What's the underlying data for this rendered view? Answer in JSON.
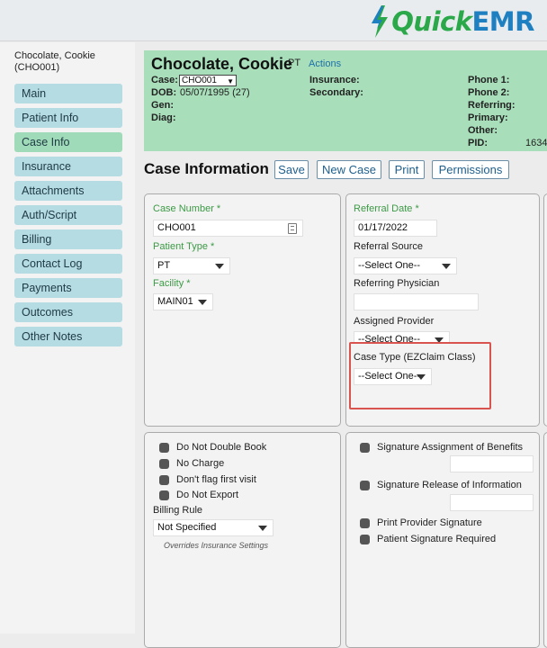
{
  "app": {
    "logo_quick": "Quick",
    "logo_emr": "EMR"
  },
  "patient": {
    "name_line1": "Chocolate, Cookie",
    "name_line2": "(CHO001)"
  },
  "sidebar": {
    "items": [
      {
        "label": "Main",
        "active": false
      },
      {
        "label": "Patient Info",
        "active": false
      },
      {
        "label": "Case Info",
        "active": true
      },
      {
        "label": "Insurance",
        "active": false
      },
      {
        "label": "Attachments",
        "active": false
      },
      {
        "label": "Auth/Script",
        "active": false
      },
      {
        "label": "Billing",
        "active": false
      },
      {
        "label": "Contact Log",
        "active": false
      },
      {
        "label": "Payments",
        "active": false
      },
      {
        "label": "Outcomes",
        "active": false
      },
      {
        "label": "Other Notes",
        "active": false
      }
    ]
  },
  "banner": {
    "name": "Chocolate, Cookie",
    "patient_type": "PT",
    "actions_label": "Actions",
    "case_label": "Case:",
    "case_value": "CHO001",
    "dob_label": "DOB:",
    "dob_value": "05/07/1995 (27)",
    "gen_label": "Gen:",
    "diag_label": "Diag:",
    "insurance_label": "Insurance:",
    "secondary_label": "Secondary:",
    "phone1_label": "Phone 1:",
    "phone2_label": "Phone 2:",
    "referring_label": "Referring:",
    "primary_label": "Primary:",
    "other_label": "Other:",
    "pid_label": "PID:",
    "pid_value": "1634"
  },
  "case_info": {
    "title": "Case Information",
    "buttons": {
      "save": "Save",
      "new_case": "New Case",
      "print": "Print",
      "permissions": "Permissions"
    }
  },
  "panel1": {
    "case_number_label": "Case Number *",
    "case_number_value": "CHO001",
    "patient_type_label": "Patient Type *",
    "patient_type_value": "PT",
    "facility_label": "Facility *",
    "facility_value": "MAIN01"
  },
  "panel2": {
    "referral_date_label": "Referral Date *",
    "referral_date_value": "01/17/2022",
    "referral_source_label": "Referral Source",
    "referral_source_value": "--Select One--",
    "referring_physician_label": "Referring Physician",
    "referring_physician_value": "",
    "assigned_provider_label": "Assigned Provider",
    "assigned_provider_value": "--Select One--",
    "case_type_label": "Case Type (EZClaim Class)",
    "case_type_value": "--Select One--"
  },
  "panel3": {
    "do_not_double_book": "Do Not Double Book",
    "no_charge": "No Charge",
    "dont_flag_first_visit": "Don't flag first visit",
    "do_not_export": "Do Not Export",
    "billing_rule_label": "Billing Rule",
    "billing_rule_value": "Not Specified",
    "billing_note": "Overrides Insurance Settings"
  },
  "panel4": {
    "sig_assignment": "Signature Assignment of Benefits",
    "sig_release": "Signature Release of Information",
    "print_provider_sig": "Print Provider Signature",
    "patient_sig_required": "Patient Signature Required"
  },
  "colors": {
    "banner_bg": "#a8dfba",
    "nav_bg": "#b5dbe3",
    "nav_active_bg": "#9fdbb8",
    "required_label": "#3c9a45",
    "highlight_border": "#d9534f",
    "logo_green": "#2aa84a",
    "logo_blue": "#1e7fc1"
  }
}
